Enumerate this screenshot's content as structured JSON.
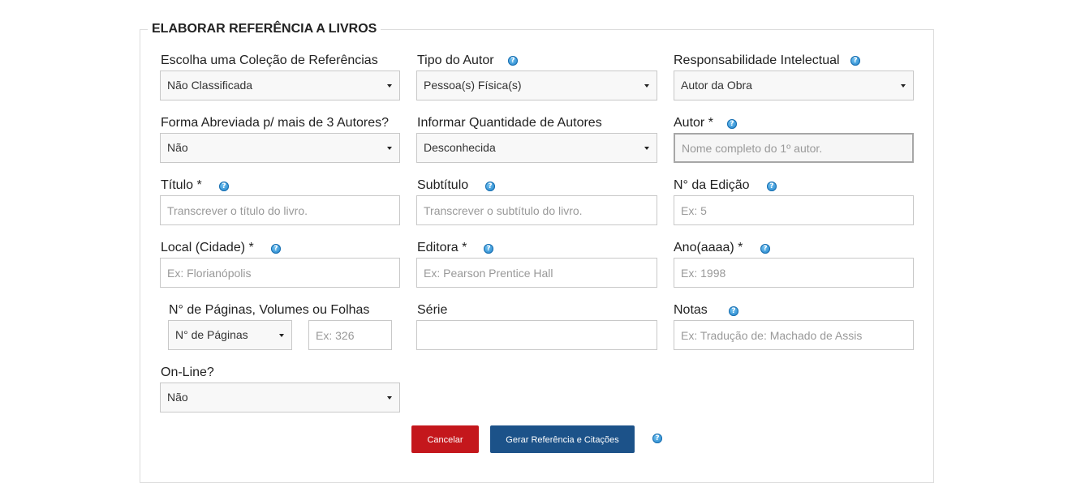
{
  "form": {
    "legend": "ELABORAR REFERÊNCIA A LIVROS",
    "help_glyph": "?",
    "colecao": {
      "label": "Escolha uma Coleção de Referências",
      "value": "Não Classificada"
    },
    "tipo_autor": {
      "label": "Tipo do Autor",
      "value": "Pessoa(s) Física(s)"
    },
    "responsabilidade": {
      "label": "Responsabilidade Intelectual",
      "value": "Autor da Obra"
    },
    "forma_abreviada": {
      "label": "Forma Abreviada p/ mais de 3 Autores?",
      "value": "Não"
    },
    "quantidade_autores": {
      "label": "Informar Quantidade de Autores",
      "value": "Desconhecida"
    },
    "autor": {
      "label": "Autor *",
      "placeholder": "Nome completo do 1º autor."
    },
    "titulo": {
      "label": "Título *",
      "placeholder": "Transcrever o título do livro."
    },
    "subtitulo": {
      "label": "Subtítulo",
      "placeholder": "Transcrever o subtítulo do livro."
    },
    "edicao": {
      "label": "N° da Edição",
      "placeholder": "Ex: 5"
    },
    "local": {
      "label": "Local (Cidade) *",
      "placeholder": "Ex: Florianópolis"
    },
    "editora": {
      "label": "Editora *",
      "placeholder": "Ex: Pearson Prentice Hall"
    },
    "ano": {
      "label": "Ano(aaaa) *",
      "placeholder": "Ex: 1998"
    },
    "paginas": {
      "label": "N° de Páginas, Volumes ou Folhas",
      "type_value": "N° de Páginas",
      "placeholder": "Ex: 326"
    },
    "serie": {
      "label": "Série",
      "placeholder": ""
    },
    "notas": {
      "label": "Notas",
      "placeholder": "Ex: Tradução de: Machado de Assis"
    },
    "online": {
      "label": "On-Line?",
      "value": "Não"
    }
  },
  "actions": {
    "cancel_label": "Cancelar",
    "generate_label": "Gerar Referência e Citações"
  },
  "colors": {
    "cancel": "#c4171c",
    "primary": "#1c5289",
    "help": "#1c7fc8"
  }
}
